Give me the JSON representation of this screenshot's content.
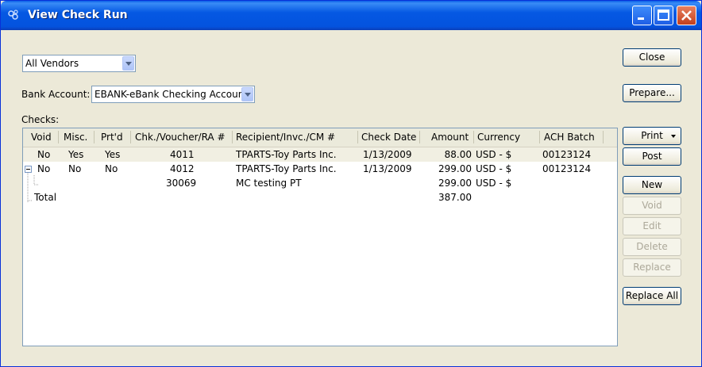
{
  "window": {
    "title": "View Check Run"
  },
  "vendor_select": {
    "value": "All Vendors"
  },
  "bank_account": {
    "label": "Bank Account:",
    "value": "EBANK-eBank Checking Account"
  },
  "checks": {
    "label": "Checks:",
    "columns": [
      "Void",
      "Misc.",
      "Prt'd",
      "Chk./Voucher/RA #",
      "Recipient/Invc./CM #",
      "Check Date",
      "Amount",
      "Currency",
      "ACH Batch"
    ],
    "rows": [
      {
        "void": "No",
        "misc": "Yes",
        "prtd": "Yes",
        "number": "4011",
        "recipient": "TPARTS-Toy Parts Inc.",
        "date": "1/13/2009",
        "amount": "88.00",
        "currency": "USD - $",
        "ach": "00123124"
      },
      {
        "void": "No",
        "misc": "No",
        "prtd": "No",
        "number": "4012",
        "recipient": "TPARTS-Toy Parts Inc.",
        "date": "1/13/2009",
        "amount": "299.00",
        "currency": "USD - $",
        "ach": "00123124"
      },
      {
        "void": "",
        "misc": "",
        "prtd": "",
        "number": "30069",
        "recipient": "MC testing PT",
        "date": "",
        "amount": "299.00",
        "currency": "USD - $",
        "ach": ""
      },
      {
        "void": "Total",
        "misc": "",
        "prtd": "",
        "number": "",
        "recipient": "",
        "date": "",
        "amount": "387.00",
        "currency": "",
        "ach": ""
      }
    ]
  },
  "buttons": {
    "close": "Close",
    "prepare": "Prepare...",
    "print": "Print",
    "post": "Post",
    "new": "New",
    "void": "Void",
    "edit": "Edit",
    "delete": "Delete",
    "replace": "Replace",
    "replace_all": "Replace All"
  }
}
